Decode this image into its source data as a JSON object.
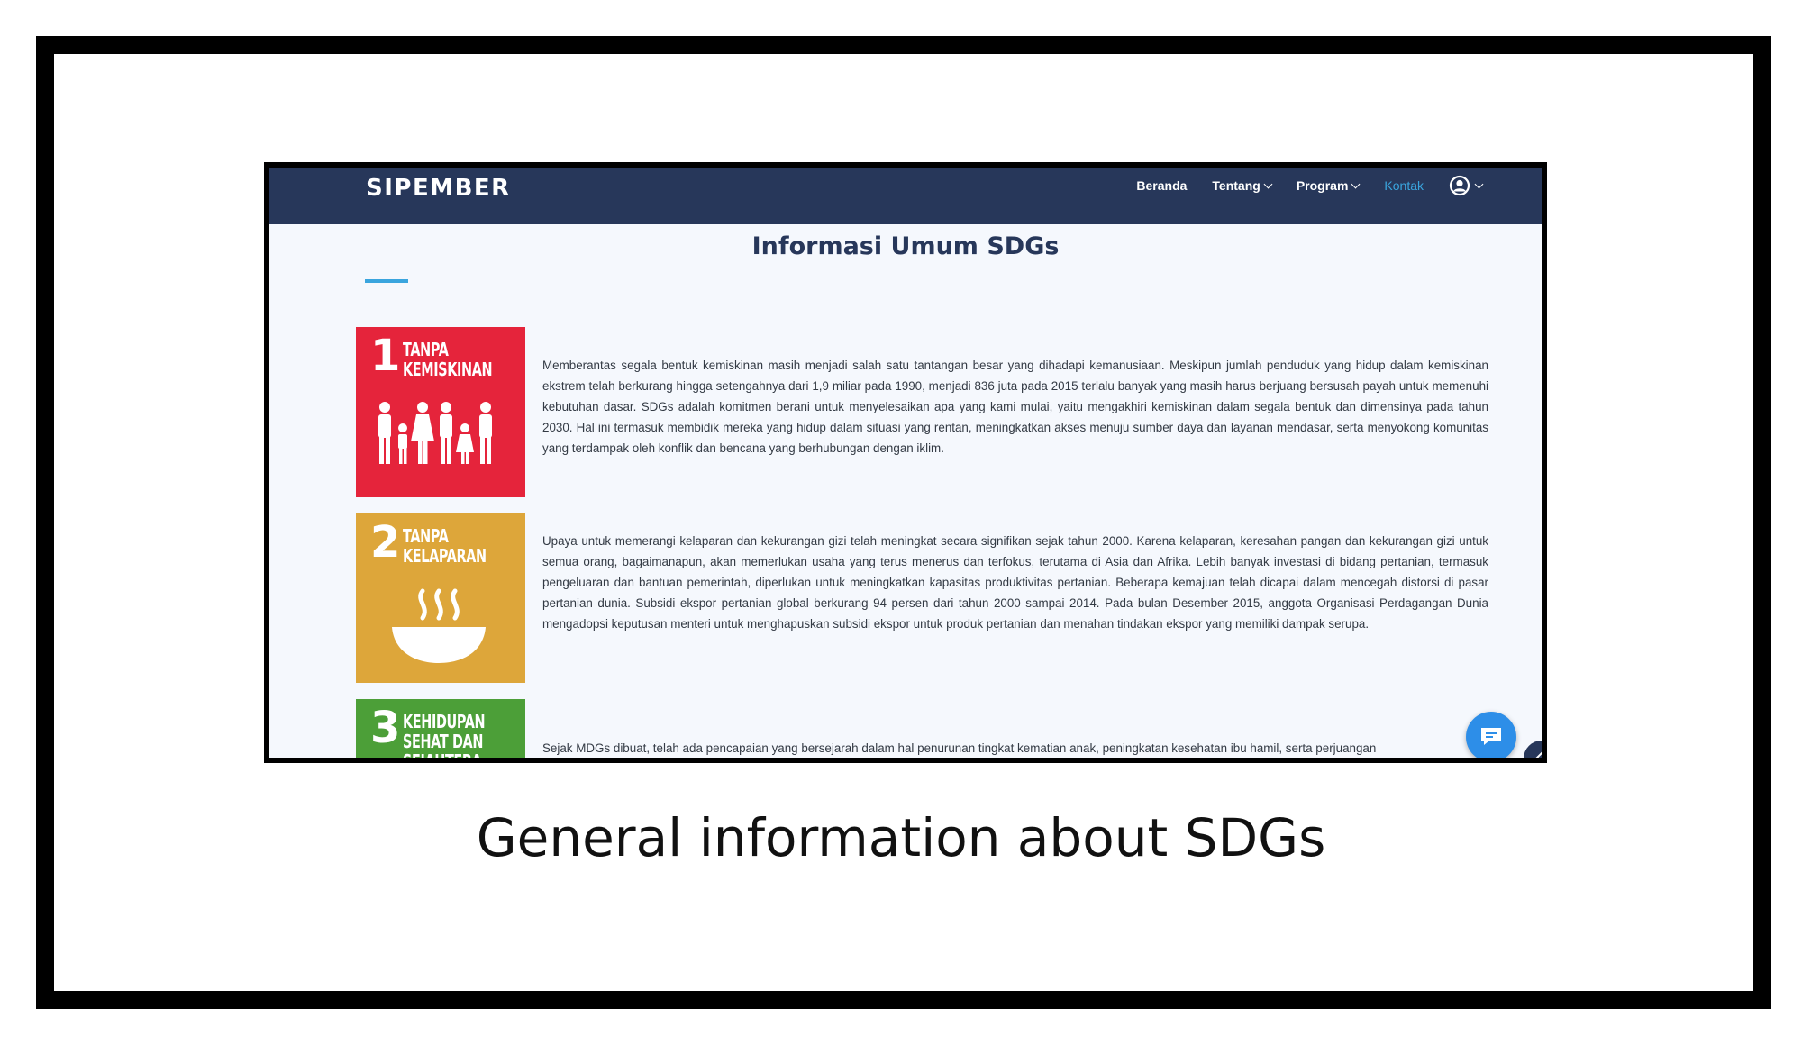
{
  "app": {
    "brand": "SIPEMBER",
    "nav": [
      {
        "label": "Beranda",
        "dropdown": false,
        "active": false
      },
      {
        "label": "Tentang",
        "dropdown": true,
        "active": false
      },
      {
        "label": "Program",
        "dropdown": true,
        "active": false
      },
      {
        "label": "Kontak",
        "dropdown": false,
        "active": true
      }
    ],
    "user_icon": "user-circle-icon",
    "colors": {
      "navbar": "#27375a",
      "accent": "#3aa5de",
      "page_bg": "#f5f8fd"
    }
  },
  "main": {
    "title": "Informasi Umum SDGs",
    "goals": [
      {
        "number": "1",
        "label": "TANPA KEMISKINAN",
        "color": "#e5243b",
        "icon": "family-icon",
        "description": "Memberantas segala bentuk kemiskinan masih menjadi salah satu tantangan besar yang dihadapi kemanusiaan. Meskipun jumlah penduduk yang hidup dalam kemiskinan ekstrem telah berkurang hingga setengahnya dari 1,9 miliar pada 1990, menjadi 836 juta pada 2015 terlalu banyak yang masih harus berjuang bersusah payah untuk memenuhi kebutuhan dasar. SDGs adalah komitmen berani untuk menyelesaikan apa yang kami mulai, yaitu mengakhiri kemiskinan dalam segala bentuk dan dimensinya pada tahun 2030. Hal ini termasuk membidik mereka yang hidup dalam situasi yang rentan, meningkatkan akses menuju sumber daya dan layanan mendasar, serta menyokong komunitas yang terdampak oleh konflik dan bencana yang berhubungan dengan iklim."
      },
      {
        "number": "2",
        "label": "TANPA KELAPARAN",
        "color": "#dda63a",
        "icon": "steaming-bowl-icon",
        "description": "Upaya untuk memerangi kelaparan dan kekurangan gizi telah meningkat secara signifikan sejak tahun 2000. Karena kelaparan, keresahan pangan dan kekurangan gizi untuk semua orang, bagaimanapun, akan memerlukan usaha yang terus menerus dan terfokus, terutama di Asia dan Afrika. Lebih banyak investasi di bidang pertanian, termasuk pengeluaran dan bantuan pemerintah, diperlukan untuk meningkatkan kapasitas produktivitas pertanian. Beberapa kemajuan telah dicapai dalam mencegah distorsi di pasar pertanian dunia. Subsidi ekspor pertanian global berkurang 94 persen dari tahun 2000 sampai 2014. Pada bulan Desember 2015, anggota Organisasi Perdagangan Dunia mengadopsi keputusan menteri untuk menghapuskan subsidi ekspor untuk produk pertanian dan menahan tindakan ekspor yang memiliki dampak serupa."
      },
      {
        "number": "3",
        "label": "KEHIDUPAN SEHAT DAN SEJAHTERA",
        "color": "#4c9f38",
        "description": "Sejak MDGs dibuat, telah ada pencapaian yang bersejarah dalam hal penurunan tingkat kematian anak, peningkatan kesehatan ibu hamil, serta perjuangan"
      }
    ]
  },
  "widgets": {
    "chat_icon": "chat-bubble-icon",
    "scroll_icon": "arrow-up-icon"
  },
  "caption": "General information about SDGs"
}
